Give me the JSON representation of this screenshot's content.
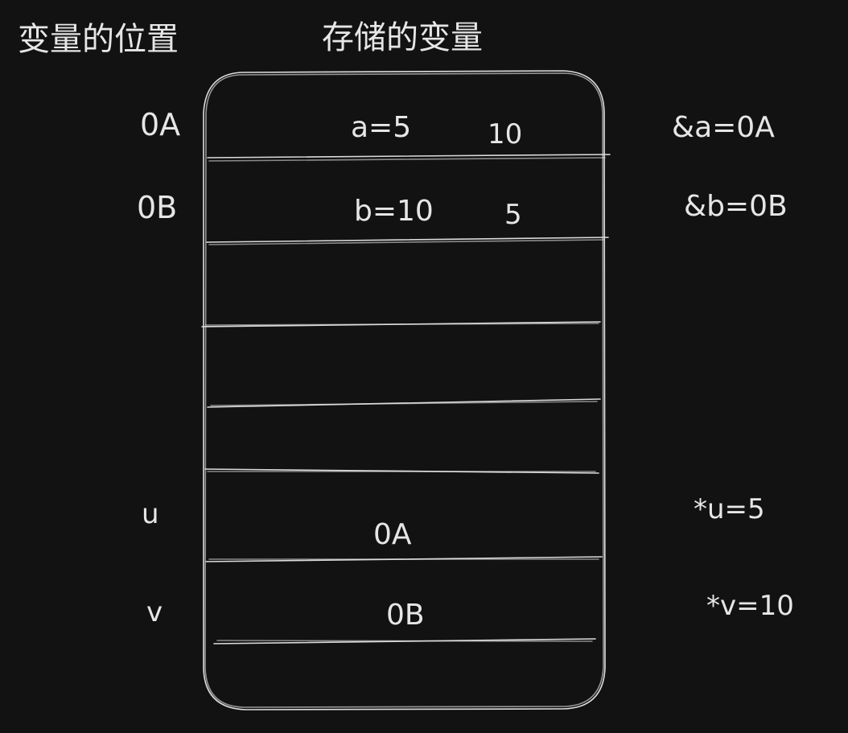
{
  "headers": {
    "location": "变量的位置",
    "stored": "存储的变量"
  },
  "rows": [
    {
      "address": "0A",
      "content": "a=5",
      "swapped": "10",
      "note": "&a=0A"
    },
    {
      "address": "0B",
      "content": "b=10",
      "swapped": "5",
      "note": "&b=0B"
    },
    {
      "address": "",
      "content": "",
      "swapped": "",
      "note": ""
    },
    {
      "address": "",
      "content": "",
      "swapped": "",
      "note": ""
    },
    {
      "address": "",
      "content": "",
      "swapped": "",
      "note": ""
    },
    {
      "address": "u",
      "content": "0A",
      "swapped": "",
      "note": "*u=5"
    },
    {
      "address": "v",
      "content": "0B",
      "swapped": "",
      "note": "*v=10"
    }
  ]
}
